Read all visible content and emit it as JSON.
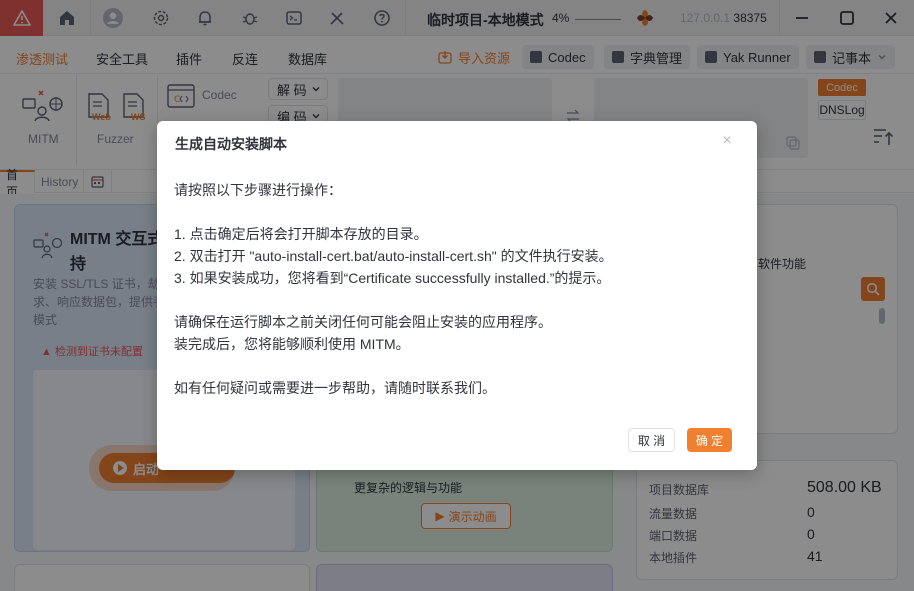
{
  "titlebar": {
    "project_title": "临时项目-本地模式",
    "progress_text": "4%",
    "address_ip": "127.0.0.1",
    "address_port": "38375"
  },
  "menu": {
    "items": [
      "渗透测试",
      "安全工具",
      "插件",
      "反连",
      "数据库"
    ],
    "import_label": "导入资源",
    "chips": [
      "Codec",
      "字典管理",
      "Yak Runner",
      "记事本"
    ]
  },
  "toolbar": {
    "mitm_label": "MITM",
    "fuzzer_label": "Fuzzer",
    "codec_label": "Codec",
    "decode_label": "解 码",
    "encode_label": "编 码",
    "codec_tag": "Codec",
    "dnslog_tag": "DNSLog",
    "web_label": "Web",
    "ws_label": "WS"
  },
  "tabs": [
    "首页",
    "History"
  ],
  "background": {
    "mitm_title_1": "MITM 交互式",
    "mitm_title_2": "持",
    "mitm_desc_1": "安装 SSL/TLS 证书，劫",
    "mitm_desc_2": "求、响应数据包，提供手",
    "mitm_desc_3": "模式",
    "cert_warning": "检测到证书未配置",
    "start_label": "启动",
    "middle_desc": "更复杂的逻辑与功能",
    "demo_label": "演示动画",
    "right_label": "软件功能",
    "stats": [
      {
        "label": "项目数据库",
        "value": "508.00 KB"
      },
      {
        "label": "流量数据",
        "value": "0"
      },
      {
        "label": "端口数据",
        "value": "0"
      },
      {
        "label": "本地插件",
        "value": "41"
      }
    ]
  },
  "modal": {
    "title": "生成自动安装脚本",
    "intro": "请按照以下步骤进行操作：",
    "step1": "1. 点击确定后将会打开脚本存放的目录。",
    "step2": "2. 双击打开 \"auto-install-cert.bat/auto-install-cert.sh\" 的文件执行安装。",
    "step3": "3. 如果安装成功，您将看到“Certificate successfully installed.”的提示。",
    "note1": "请确保在运行脚本之前关闭任何可能会阻止安装的应用程序。",
    "note2": "装完成后，您将能够顺利使用 MITM。",
    "help": "如有任何疑问或需要进一步帮助，请随时联系我们。",
    "cancel_label": "取 消",
    "ok_label": "确 定"
  }
}
